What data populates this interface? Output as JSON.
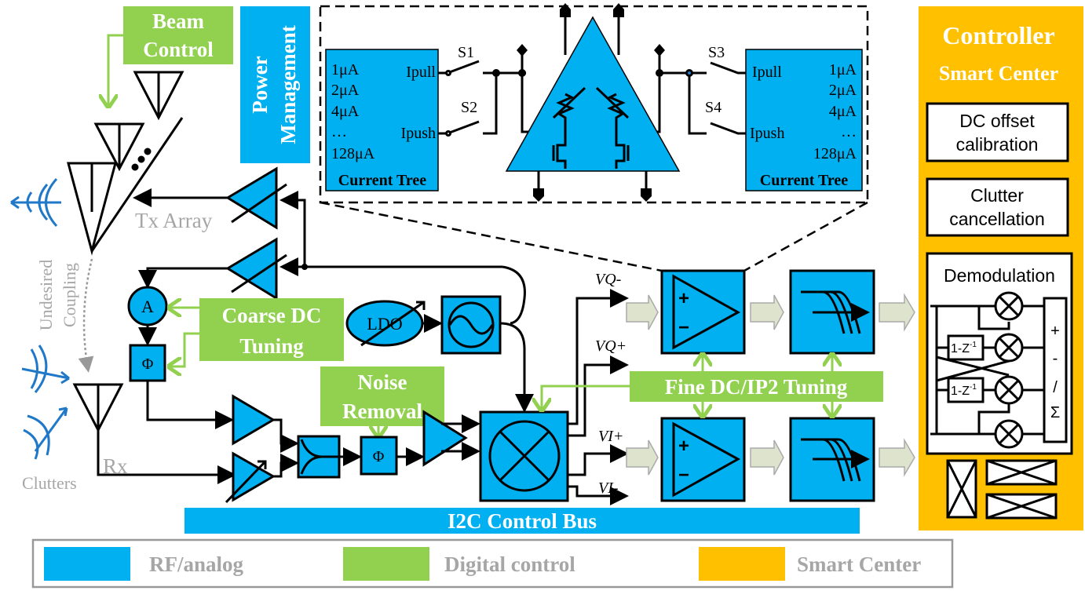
{
  "colors": {
    "rf_analog": "#00b0f0",
    "digital": "#92d050",
    "smart": "#ffc000",
    "gray_text": "#a6a6a6",
    "signal": "#1f78c8"
  },
  "labels": {
    "beam_control": [
      "Beam",
      "Control"
    ],
    "power_management": [
      "Power",
      "Management"
    ],
    "tx_array": "Tx Array",
    "rx": "Rx",
    "undesired_coupling": [
      "Undesired",
      "Coupling"
    ],
    "clutters": "Clutters",
    "coarse_dc": [
      "Coarse DC",
      "Tuning"
    ],
    "noise_removal": [
      "Noise",
      "Removal"
    ],
    "fine_dc": "Fine DC/IP2 Tuning",
    "ldo": "LDO",
    "amp_gain": "A",
    "phase": "Φ",
    "i2c": "I2C Control Bus",
    "vq_minus": "VQ-",
    "vq_plus": "VQ+",
    "vi_plus": "VI+",
    "vi_minus": "VI-",
    "plus": "+",
    "minus": "−"
  },
  "current_tree": {
    "values": [
      "1μA",
      "2μA",
      "4μA",
      "…",
      "128μA"
    ],
    "ipull": "Ipull",
    "ipush": "Ipush",
    "title": "Current Tree",
    "switches": [
      "S1",
      "S2",
      "S3",
      "S4"
    ]
  },
  "controller": {
    "title": "Controller",
    "subtitle": "Smart Center",
    "dc_offset": [
      "DC offset",
      "calibration"
    ],
    "clutter": [
      "Clutter",
      "cancellation"
    ],
    "demod": "Demodulation",
    "delay": "1-Z",
    "delay_exp": "-1",
    "sum_ops": [
      "+",
      "-",
      "/",
      "Σ"
    ]
  },
  "legend": [
    {
      "label": "RF/analog",
      "color": "#00b0f0"
    },
    {
      "label": "Digital control",
      "color": "#92d050"
    },
    {
      "label": "Smart Center",
      "color": "#ffc000"
    }
  ]
}
